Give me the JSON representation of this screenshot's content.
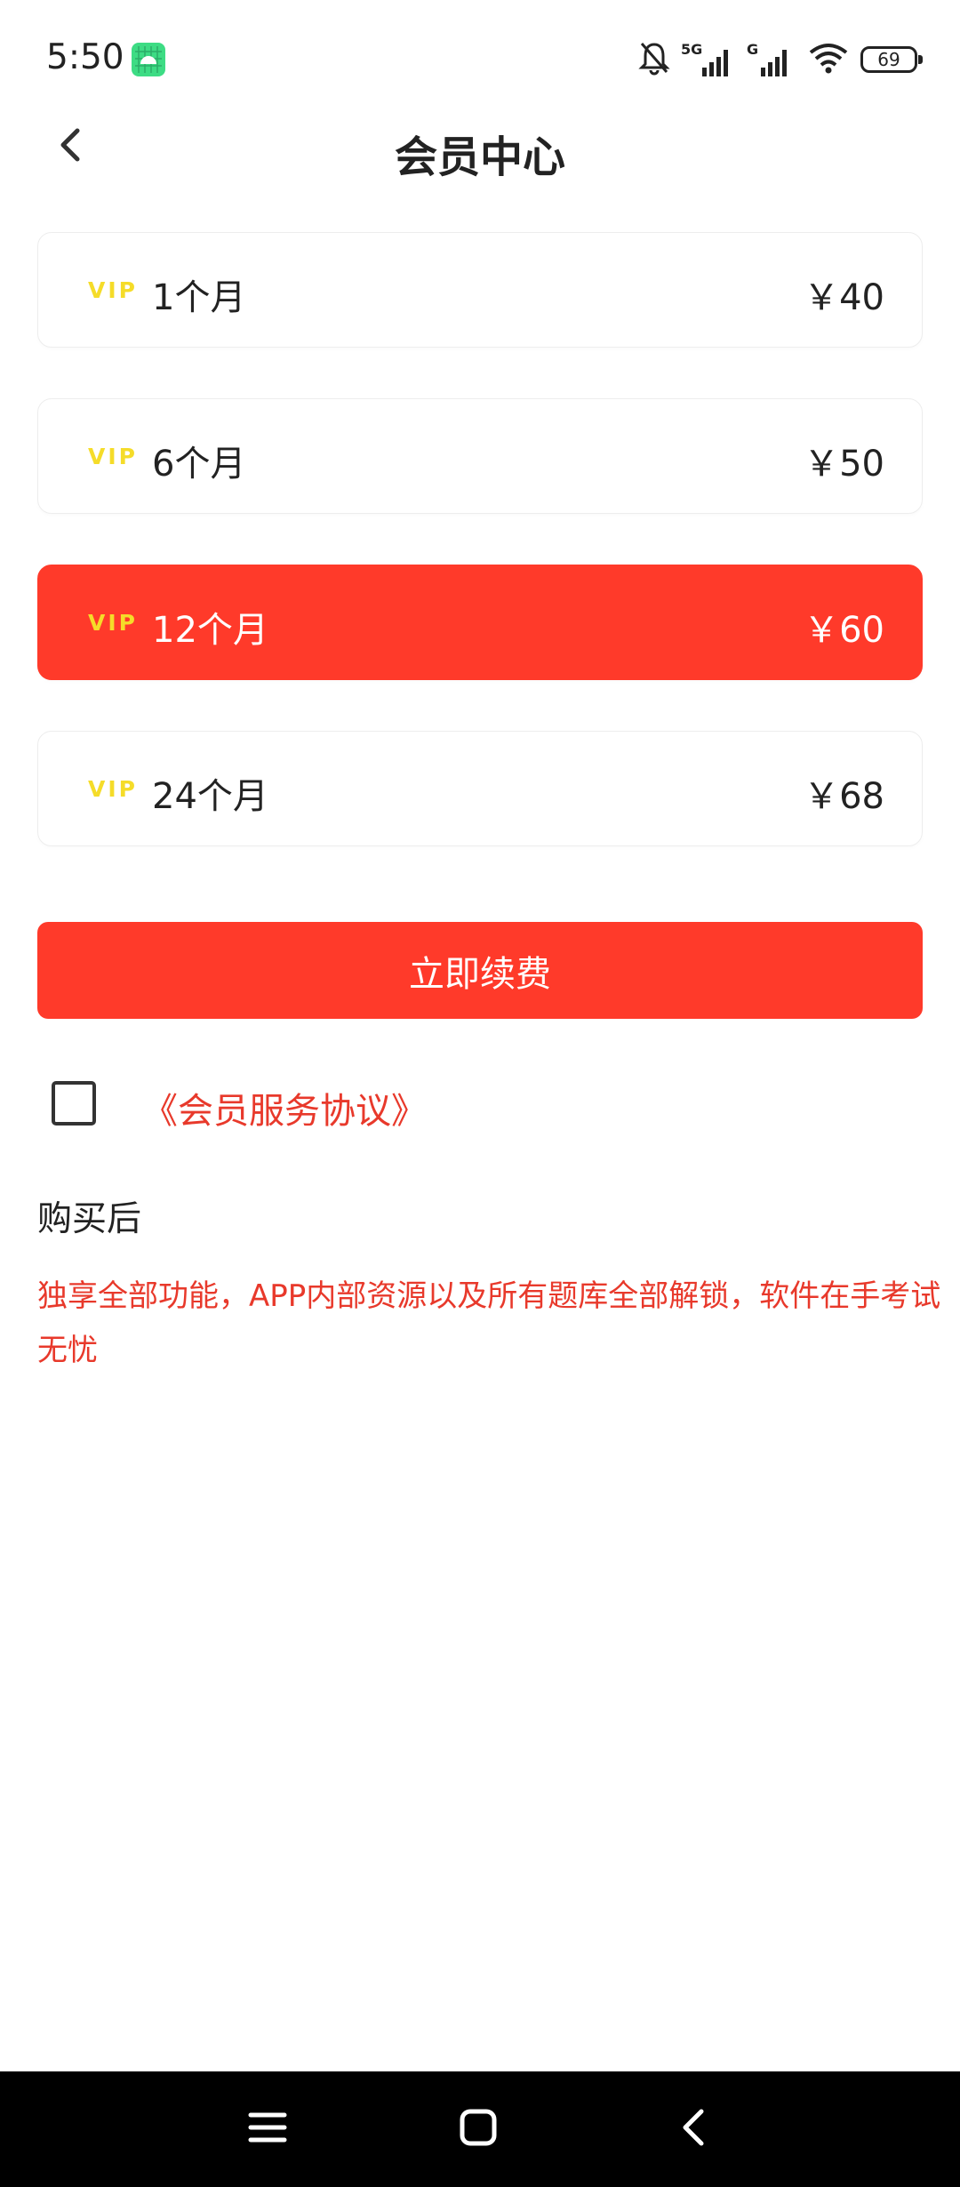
{
  "status_bar": {
    "time": "5:50",
    "battery_level": "69",
    "signal_labels": [
      "5G",
      "G"
    ]
  },
  "header": {
    "title": "会员中心"
  },
  "plans": [
    {
      "badge": "VIP",
      "label": "1个月",
      "price": "￥40",
      "selected": false
    },
    {
      "badge": "VIP",
      "label": "6个月",
      "price": "￥50",
      "selected": false
    },
    {
      "badge": "VIP",
      "label": "12个月",
      "price": "￥60",
      "selected": true
    },
    {
      "badge": "VIP",
      "label": "24个月",
      "price": "￥68",
      "selected": false
    }
  ],
  "renew_button": {
    "label": "立即续费"
  },
  "agreement": {
    "link_text": "《会员服务协议》",
    "checked": false
  },
  "after_purchase": {
    "heading": "购买后",
    "description": "独享全部功能，APP内部资源以及所有题库全部解锁，软件在手考试无忧"
  },
  "colors": {
    "accent": "#ff3a2a",
    "link": "#e8392b",
    "vip_badge": "#f5dc29"
  }
}
